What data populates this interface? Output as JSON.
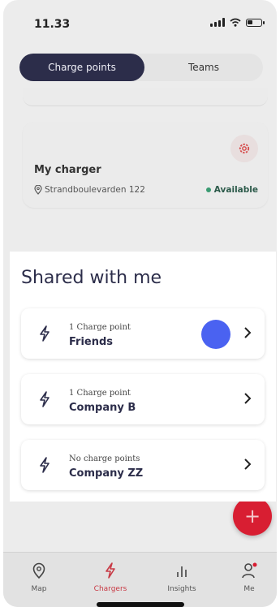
{
  "status_bar": {
    "time": "11.33"
  },
  "segmented_control": {
    "active": "Charge points",
    "inactive": "Teams"
  },
  "charger_card": {
    "title": "My charger",
    "address": "Strandboulevarden 122",
    "status": "Available"
  },
  "shared_section": {
    "title": "Shared with me",
    "items": [
      {
        "subtitle": "1 Charge point",
        "name": "Friends"
      },
      {
        "subtitle": "1 Charge point",
        "name": "Company B"
      },
      {
        "subtitle": "No charge points",
        "name": "Company ZZ"
      }
    ]
  },
  "fab": {
    "symbol": "+"
  },
  "nav": {
    "map": "Map",
    "chargers": "Chargers",
    "insights": "Insights",
    "me": "Me"
  },
  "colors": {
    "primary_dark": "#2c2d4a",
    "accent_red": "#d81e32",
    "available_green": "#3a9b72",
    "touch_blue": "#4a62f1"
  },
  "icons": [
    "gear-icon",
    "location-pin-icon",
    "bolt-icon",
    "chevron-right-icon",
    "map-pin-icon",
    "chart-icon",
    "person-icon",
    "plus-icon"
  ]
}
